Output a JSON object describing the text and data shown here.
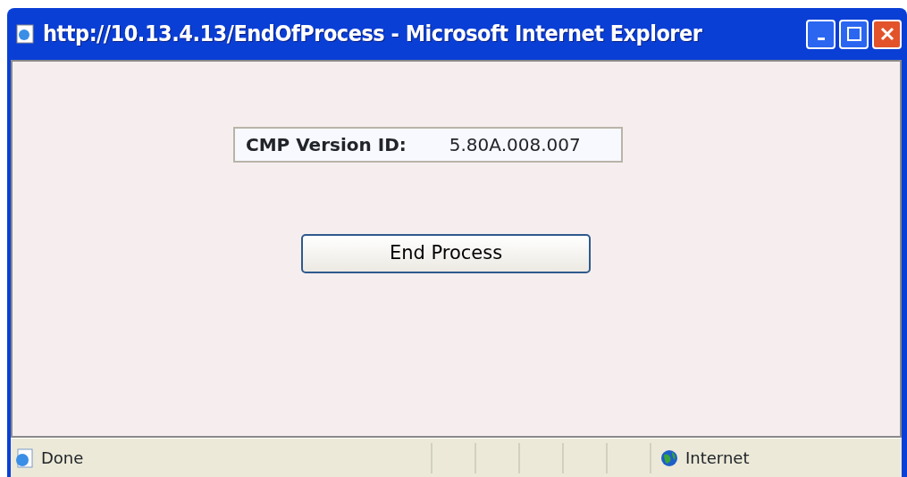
{
  "window": {
    "title": "http://10.13.4.13/EndOfProcess - Microsoft Internet Explorer"
  },
  "version": {
    "label": "CMP Version ID:",
    "value": "5.80A.008.007"
  },
  "button": {
    "label": "End Process"
  },
  "status_bar": {
    "text": "Done",
    "zone": "Internet"
  }
}
